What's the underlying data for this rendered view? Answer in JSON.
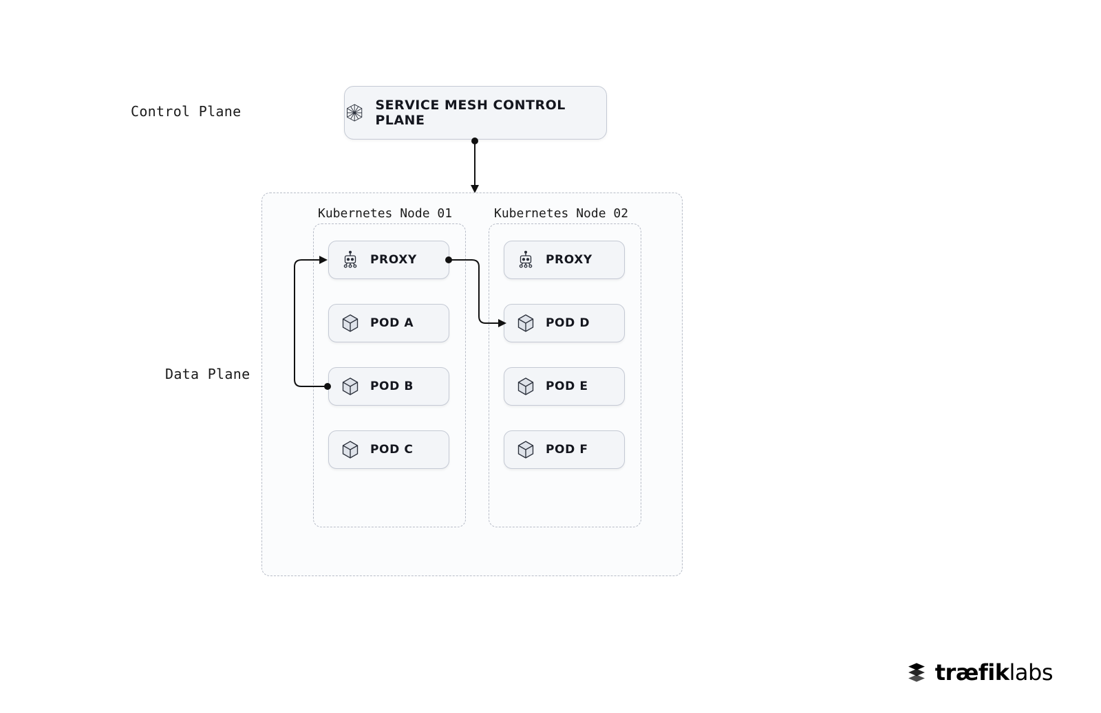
{
  "labels": {
    "control_plane": "Control Plane",
    "data_plane": "Data Plane"
  },
  "control_box": {
    "title": "SERVICE MESH CONTROL PLANE"
  },
  "nodes": [
    {
      "title": "Kubernetes Node 01",
      "items": [
        {
          "kind": "proxy",
          "label": "PROXY"
        },
        {
          "kind": "pod",
          "label": "POD A"
        },
        {
          "kind": "pod",
          "label": "POD B"
        },
        {
          "kind": "pod",
          "label": "POD C"
        }
      ]
    },
    {
      "title": "Kubernetes Node 02",
      "items": [
        {
          "kind": "proxy",
          "label": "PROXY"
        },
        {
          "kind": "pod",
          "label": "POD D"
        },
        {
          "kind": "pod",
          "label": "POD E"
        },
        {
          "kind": "pod",
          "label": "POD F"
        }
      ]
    }
  ],
  "connectors": [
    {
      "from": "control-plane-box",
      "to": "data-plane-box",
      "desc": "control to data plane"
    },
    {
      "from": "node1-pod-b",
      "to": "node1-proxy",
      "desc": "pod b to proxy"
    },
    {
      "from": "node1-proxy",
      "to": "node2-pod-d",
      "desc": "proxy to pod d"
    }
  ],
  "brand": {
    "name": "træfiklabs"
  }
}
